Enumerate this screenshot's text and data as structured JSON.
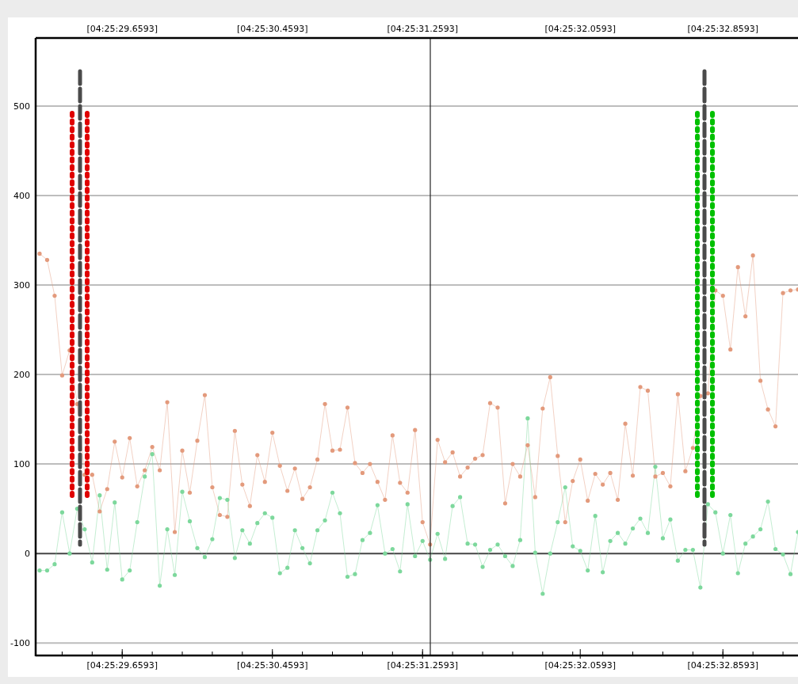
{
  "top_axis": {
    "labels": [
      "[04:25:29.6593]",
      "[04:25:30.4593]",
      "[04:25:31.2593]",
      "[04:25:32.0593]",
      "[04:25:32.8593]"
    ]
  },
  "chart_data": {
    "type": "line",
    "grid": true,
    "ylim": [
      -114,
      576
    ],
    "categories": [
      null,
      null,
      null,
      null,
      null,
      null,
      null,
      null,
      null,
      null,
      null,
      "[04:25:29.6593]",
      null,
      null,
      null,
      null,
      null,
      null,
      null,
      null,
      null,
      null,
      null,
      null,
      null,
      null,
      null,
      null,
      null,
      null,
      null,
      "[04:25:30.4593]",
      null,
      null,
      null,
      null,
      null,
      null,
      null,
      null,
      null,
      null,
      null,
      null,
      null,
      null,
      null,
      null,
      null,
      null,
      null,
      "[04:25:31.2593]",
      null,
      null,
      null,
      null,
      null,
      null,
      null,
      null,
      null,
      null,
      null,
      null,
      null,
      null,
      null,
      null,
      null,
      null,
      null,
      null,
      "[04:25:32.0593]",
      null,
      null,
      null,
      null,
      null,
      null,
      null,
      null,
      null,
      null,
      null,
      null,
      null,
      null,
      null,
      null,
      null,
      null,
      "[04:25:32.8593]",
      null,
      null,
      null,
      null,
      null,
      null,
      null,
      null,
      null,
      null
    ],
    "yticks": [
      -100,
      0,
      100,
      200,
      300,
      400,
      500
    ],
    "series": [
      {
        "color": "#e39a7c",
        "values": [
          335,
          328,
          288,
          199,
          227,
          167,
          88,
          88,
          47,
          72,
          125,
          85,
          129,
          75,
          93,
          119,
          93,
          169,
          24,
          115,
          68,
          126,
          177,
          74,
          43,
          41,
          137,
          77,
          53,
          110,
          80,
          135,
          98,
          70,
          95,
          61,
          74,
          105,
          167,
          115,
          116,
          163,
          101,
          90,
          100,
          80,
          60,
          132,
          79,
          68,
          138,
          35,
          10,
          127,
          102,
          113,
          86,
          96,
          106,
          110,
          168,
          163,
          56,
          100,
          86,
          121,
          63,
          162,
          197,
          109,
          35,
          81,
          105,
          59,
          89,
          77,
          90,
          60,
          145,
          87,
          186,
          182,
          86,
          90,
          75,
          178,
          92,
          118,
          176,
          179,
          294,
          288,
          228,
          320,
          265,
          333,
          193,
          161,
          142,
          291,
          294,
          295
        ]
      },
      {
        "color": "#7dd89c",
        "values": [
          -19,
          -19,
          -12,
          46,
          0,
          50,
          27,
          -10,
          65,
          -18,
          57,
          -29,
          -19,
          35,
          86,
          111,
          -36,
          27,
          -24,
          69,
          36,
          6,
          -4,
          16,
          62,
          60,
          -5,
          26,
          11,
          34,
          45,
          40,
          -22,
          -16,
          26,
          6,
          -11,
          26,
          37,
          68,
          45,
          -26,
          -23,
          15,
          23,
          54,
          0,
          5,
          -20,
          55,
          -3,
          14,
          -7,
          22,
          -6,
          53,
          63,
          11,
          10,
          -15,
          4,
          10,
          -3,
          -14,
          15,
          151,
          1,
          -45,
          0,
          35,
          74,
          8,
          3,
          -19,
          42,
          -21,
          14,
          23,
          11,
          28,
          39,
          23,
          97,
          17,
          38,
          -8,
          4,
          4,
          -38,
          55,
          46,
          0,
          43,
          -22,
          11,
          19,
          27,
          58,
          5,
          -1,
          -23,
          24
        ]
      }
    ]
  },
  "markers": [
    {
      "kind": "start"
    },
    {
      "kind": "line"
    },
    {
      "kind": "start"
    },
    {
      "kind": "end"
    },
    {
      "kind": "line"
    },
    {
      "kind": "end"
    }
  ]
}
